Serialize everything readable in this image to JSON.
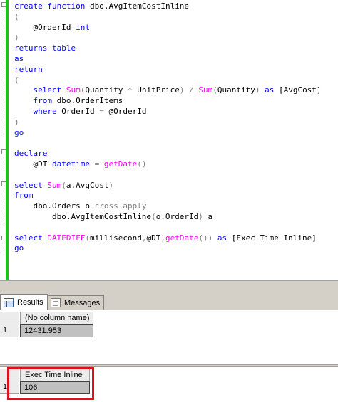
{
  "editor": {
    "lines": [
      [
        {
          "t": "create",
          "c": "kw"
        },
        {
          "t": " "
        },
        {
          "t": "function",
          "c": "kw"
        },
        {
          "t": " dbo.AvgItemCostInline"
        }
      ],
      [
        {
          "t": "(",
          "c": "gr"
        }
      ],
      [
        {
          "t": "    @OrderId "
        },
        {
          "t": "int",
          "c": "kw"
        }
      ],
      [
        {
          "t": ")",
          "c": "gr"
        }
      ],
      [
        {
          "t": "returns",
          "c": "kw"
        },
        {
          "t": " "
        },
        {
          "t": "table",
          "c": "kw"
        }
      ],
      [
        {
          "t": "as",
          "c": "kw"
        }
      ],
      [
        {
          "t": "return",
          "c": "kw"
        }
      ],
      [
        {
          "t": "(",
          "c": "gr"
        }
      ],
      [
        {
          "t": "    "
        },
        {
          "t": "select",
          "c": "kw"
        },
        {
          "t": " "
        },
        {
          "t": "Sum",
          "c": "fn"
        },
        {
          "t": "(",
          "c": "gr"
        },
        {
          "t": "Quantity "
        },
        {
          "t": "*",
          "c": "gr"
        },
        {
          "t": " UnitPrice"
        },
        {
          "t": ")",
          "c": "gr"
        },
        {
          "t": " "
        },
        {
          "t": "/",
          "c": "gr"
        },
        {
          "t": " "
        },
        {
          "t": "Sum",
          "c": "fn"
        },
        {
          "t": "(",
          "c": "gr"
        },
        {
          "t": "Quantity"
        },
        {
          "t": ")",
          "c": "gr"
        },
        {
          "t": " "
        },
        {
          "t": "as",
          "c": "kw"
        },
        {
          "t": " [AvgCost]"
        }
      ],
      [
        {
          "t": "    "
        },
        {
          "t": "from",
          "c": "kw"
        },
        {
          "t": " dbo.OrderItems"
        }
      ],
      [
        {
          "t": "    "
        },
        {
          "t": "where",
          "c": "kw"
        },
        {
          "t": " OrderId "
        },
        {
          "t": "=",
          "c": "gr"
        },
        {
          "t": " @OrderId"
        }
      ],
      [
        {
          "t": ")",
          "c": "gr"
        }
      ],
      [
        {
          "t": "go",
          "c": "kw"
        }
      ],
      [
        {
          "t": ""
        }
      ],
      [
        {
          "t": "declare",
          "c": "kw"
        }
      ],
      [
        {
          "t": "    @DT "
        },
        {
          "t": "datetime",
          "c": "kw"
        },
        {
          "t": " "
        },
        {
          "t": "=",
          "c": "gr"
        },
        {
          "t": " "
        },
        {
          "t": "getDate",
          "c": "fn"
        },
        {
          "t": "()",
          "c": "gr"
        }
      ],
      [
        {
          "t": ""
        }
      ],
      [
        {
          "t": "select",
          "c": "kw"
        },
        {
          "t": " "
        },
        {
          "t": "Sum",
          "c": "fn"
        },
        {
          "t": "(",
          "c": "gr"
        },
        {
          "t": "a.AvgCost"
        },
        {
          "t": ")",
          "c": "gr"
        }
      ],
      [
        {
          "t": "from",
          "c": "kw"
        }
      ],
      [
        {
          "t": "    dbo.Orders o "
        },
        {
          "t": "cross",
          "c": "gr"
        },
        {
          "t": " "
        },
        {
          "t": "apply",
          "c": "gr"
        }
      ],
      [
        {
          "t": "        dbo.AvgItemCostInline"
        },
        {
          "t": "(",
          "c": "gr"
        },
        {
          "t": "o.OrderId"
        },
        {
          "t": ")",
          "c": "gr"
        },
        {
          "t": " a"
        }
      ],
      [
        {
          "t": ""
        }
      ],
      [
        {
          "t": "select",
          "c": "kw"
        },
        {
          "t": " "
        },
        {
          "t": "DATEDIFF",
          "c": "fn"
        },
        {
          "t": "(",
          "c": "gr"
        },
        {
          "t": "millisecond"
        },
        {
          "t": ",",
          "c": "gr"
        },
        {
          "t": "@DT"
        },
        {
          "t": ",",
          "c": "gr"
        },
        {
          "t": "getDate",
          "c": "fn"
        },
        {
          "t": "())",
          "c": "gr"
        },
        {
          "t": " "
        },
        {
          "t": "as",
          "c": "kw"
        },
        {
          "t": " [Exec Time Inline]"
        }
      ],
      [
        {
          "t": "go",
          "c": "kw"
        }
      ]
    ]
  },
  "tabs": {
    "results_label": "Results",
    "messages_label": "Messages"
  },
  "results": {
    "grid1": {
      "column_header": "(No column name)",
      "row_number": "1",
      "value": "12431.953"
    },
    "grid2": {
      "column_header": "Exec Time Inline",
      "row_number": "1",
      "value": "106"
    }
  },
  "colors": {
    "keyword": "#0000ff",
    "function": "#ff00ff",
    "operator": "#808080",
    "change_bar": "#21c021",
    "highlight_box": "#e0101a"
  }
}
